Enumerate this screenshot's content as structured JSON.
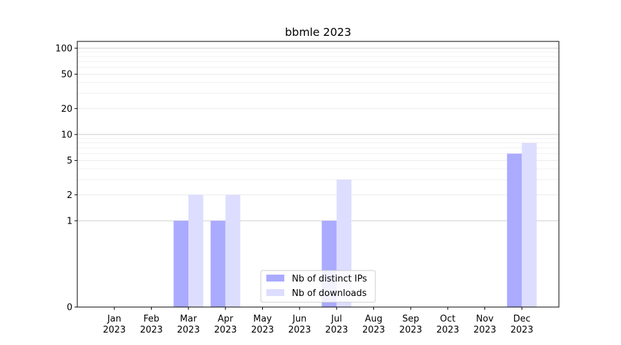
{
  "chart_data": {
    "type": "bar",
    "title": "bbmle 2023",
    "xlabel": "",
    "ylabel": "",
    "y_scale": "symlog",
    "ylim": [
      0,
      120
    ],
    "y_ticks": [
      0,
      1,
      2,
      5,
      10,
      20,
      50,
      100
    ],
    "grid": "horizontal",
    "legend_position": "bottom-center",
    "categories": [
      {
        "month": "Jan",
        "year": "2023"
      },
      {
        "month": "Feb",
        "year": "2023"
      },
      {
        "month": "Mar",
        "year": "2023"
      },
      {
        "month": "Apr",
        "year": "2023"
      },
      {
        "month": "May",
        "year": "2023"
      },
      {
        "month": "Jun",
        "year": "2023"
      },
      {
        "month": "Jul",
        "year": "2023"
      },
      {
        "month": "Aug",
        "year": "2023"
      },
      {
        "month": "Sep",
        "year": "2023"
      },
      {
        "month": "Oct",
        "year": "2023"
      },
      {
        "month": "Nov",
        "year": "2023"
      },
      {
        "month": "Dec",
        "year": "2023"
      }
    ],
    "series": [
      {
        "name": "Nb of distinct IPs",
        "color": "#aaaaff",
        "values": [
          0,
          0,
          1,
          1,
          0,
          0,
          1,
          0,
          0,
          0,
          0,
          6
        ]
      },
      {
        "name": "Nb of downloads",
        "color": "#ddddff",
        "values": [
          0,
          0,
          2,
          2,
          0,
          0,
          3,
          0,
          0,
          0,
          0,
          8
        ]
      }
    ]
  }
}
